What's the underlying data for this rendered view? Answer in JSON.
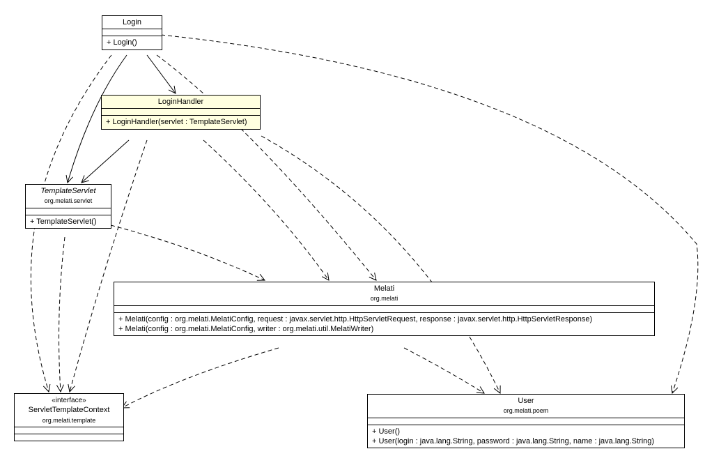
{
  "classes": {
    "login": {
      "name": "Login",
      "ops": [
        "+ Login()"
      ]
    },
    "loginHandler": {
      "name": "LoginHandler",
      "ops": [
        "+ LoginHandler(servlet : TemplateServlet)"
      ]
    },
    "templateServlet": {
      "name": "TemplateServlet",
      "pkg": "org.melati.servlet",
      "ops": [
        "+ TemplateServlet()"
      ]
    },
    "melati": {
      "name": "Melati",
      "pkg": "org.melati",
      "ops": [
        "+ Melati(config : org.melati.MelatiConfig, request : javax.servlet.http.HttpServletRequest, response : javax.servlet.http.HttpServletResponse)",
        "+ Melati(config : org.melati.MelatiConfig, writer : org.melati.util.MelatiWriter)"
      ]
    },
    "servletTemplateContext": {
      "stereo": "«interface»",
      "name": "ServletTemplateContext",
      "pkg": "org.melati.template"
    },
    "user": {
      "name": "User",
      "pkg": "org.melati.poem",
      "ops": [
        "+ User()",
        "+ User(login : java.lang.String, password : java.lang.String, name : java.lang.String)"
      ]
    }
  }
}
